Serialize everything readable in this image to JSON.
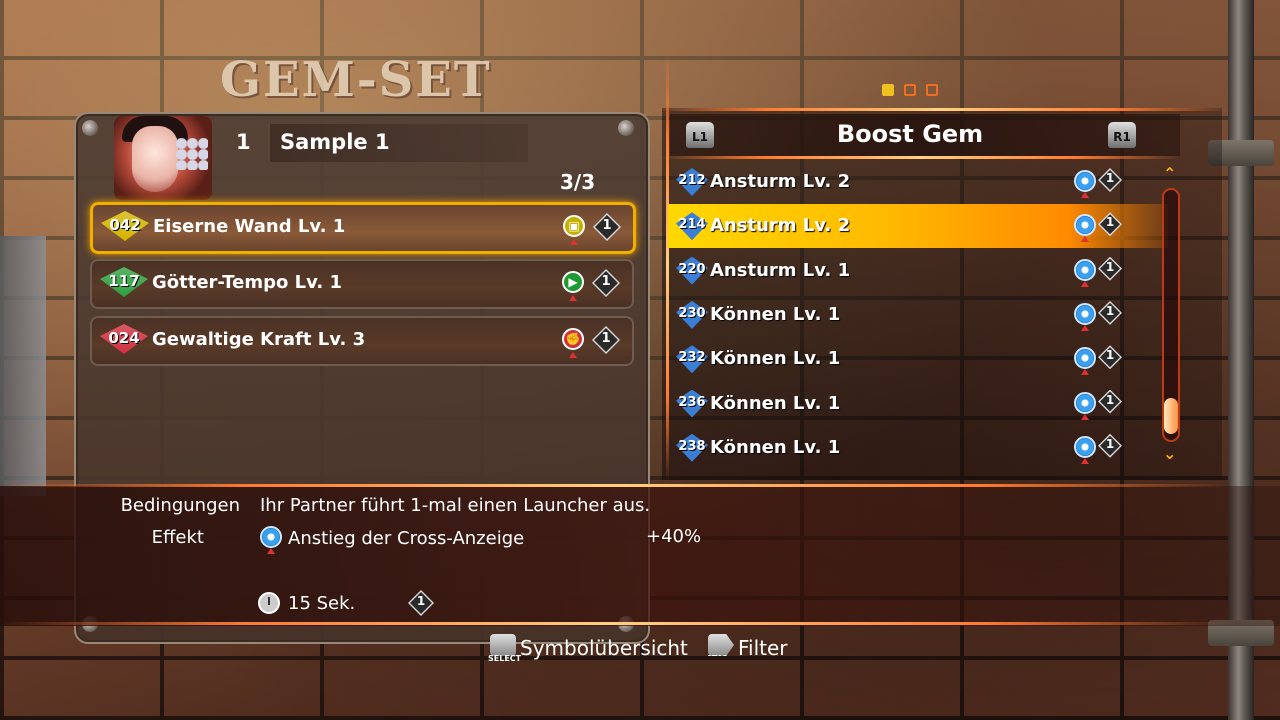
{
  "screen_title": "GEM-SET",
  "pager": {
    "pages": 3,
    "active": 0
  },
  "set": {
    "number": "1",
    "name": "Sample 1",
    "count": "3/3"
  },
  "equipped_gems": [
    {
      "code": "042",
      "name": "Eiserne Wand Lv. 1",
      "color": "#d4b400",
      "type_icon": "guard-icon",
      "type_color": "#c8b000",
      "cost": "1",
      "selected": true
    },
    {
      "code": "117",
      "name": "Götter-Tempo Lv. 1",
      "color": "#2fa040",
      "type_icon": "speed-icon",
      "type_color": "#1e9a32",
      "cost": "1",
      "selected": false
    },
    {
      "code": "024",
      "name": "Gewaltige Kraft Lv. 3",
      "color": "#d03040",
      "type_icon": "attack-icon",
      "type_color": "#d03040",
      "cost": "1",
      "selected": false
    }
  ],
  "list_header": {
    "title": "Boost Gem",
    "left_button": "L1",
    "right_button": "R1"
  },
  "gem_list": [
    {
      "code": "212",
      "name": "Ansturm Lv. 2",
      "cost": "1",
      "selected": false
    },
    {
      "code": "214",
      "name": "Ansturm Lv. 2",
      "cost": "1",
      "selected": true
    },
    {
      "code": "220",
      "name": "Ansturm Lv. 1",
      "cost": "1",
      "selected": false
    },
    {
      "code": "230",
      "name": "Können Lv. 1",
      "cost": "1",
      "selected": false
    },
    {
      "code": "232",
      "name": "Können Lv. 1",
      "cost": "1",
      "selected": false
    },
    {
      "code": "236",
      "name": "Können Lv. 1",
      "cost": "1",
      "selected": false
    },
    {
      "code": "238",
      "name": "Können Lv. 1",
      "cost": "1",
      "selected": false
    }
  ],
  "details": {
    "condition_label": "Bedingungen",
    "condition_text": "Ihr Partner führt 1-mal einen Launcher aus.",
    "effect_label": "Effekt",
    "effect_text": "Anstieg der Cross-Anzeige",
    "effect_value": "+40%",
    "duration": "15 Sek.",
    "cost": "1"
  },
  "footer": {
    "select_caption": "SELECT",
    "select_label": "Symbolübersicht",
    "start_caption": "START",
    "start_label": "Filter"
  },
  "colors": {
    "accent": "#ff7a30",
    "highlight": "#ffd800",
    "gem_blue": "#3a7ed6"
  }
}
